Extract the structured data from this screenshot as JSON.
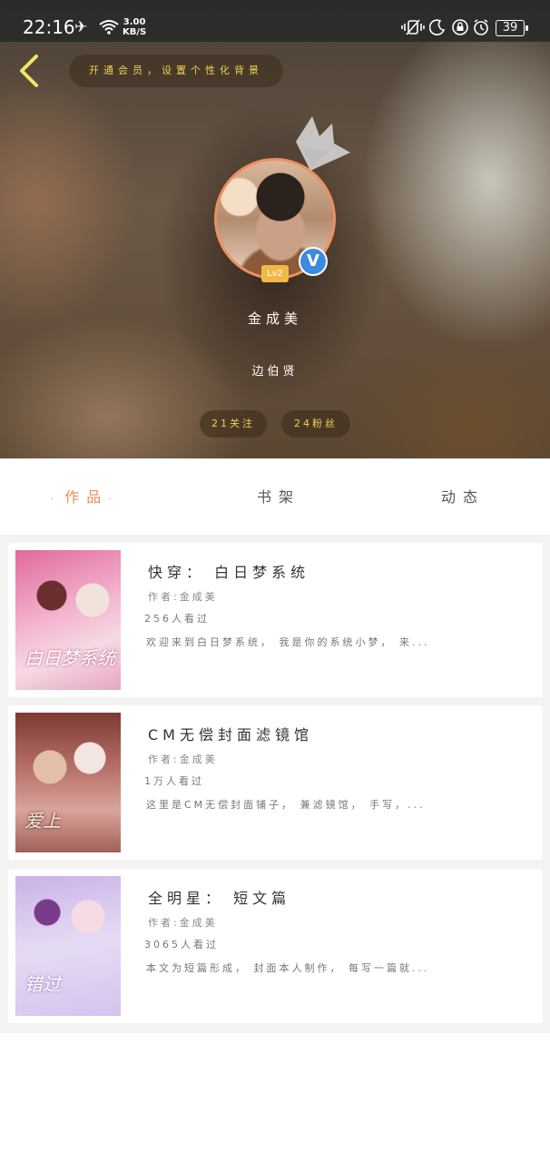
{
  "status_bar": {
    "time": "22:16",
    "net_speed_value": "3.00",
    "net_speed_unit": "KB/S",
    "battery": "39",
    "icons": [
      "airplane-icon",
      "wifi-icon",
      "vibrate-icon",
      "moon-icon",
      "lock-icon",
      "alarm-icon",
      "battery-icon"
    ]
  },
  "header": {
    "vip_prompt": "开通会员，设置个性化背景",
    "level": "Lv2",
    "verified_mark": "V",
    "username": "金成美",
    "signature": "边伯贤",
    "follow_label": "21关注",
    "fans_label": "24粉丝"
  },
  "tabs": [
    {
      "label": "作品",
      "active": true
    },
    {
      "label": "书架",
      "active": false
    },
    {
      "label": "动态",
      "active": false
    }
  ],
  "works": [
    {
      "title": "快穿： 白日梦系统",
      "author": "作者:金成美",
      "views": "256人看过",
      "desc": "欢迎来到白日梦系统， 我是你的系统小梦， 来...",
      "cover_text": "白日梦系统"
    },
    {
      "title": "CM无偿封面滤镜馆",
      "author": "作者:金成美",
      "views": "1万人看过",
      "desc": "这里是CM无偿封面铺子， 兼滤镜馆， 手写，...",
      "cover_text": "爱上"
    },
    {
      "title": "全明星： 短文篇",
      "author": "作者:金成美",
      "views": "3065人看过",
      "desc": "本文为短篇形成， 封面本人制作， 每写一篇就...",
      "cover_text": "错过"
    }
  ],
  "colors": {
    "accent": "#f08a55",
    "gold": "#f3cf54",
    "verified": "#3d8be0",
    "level_badge": "#f0b945"
  }
}
